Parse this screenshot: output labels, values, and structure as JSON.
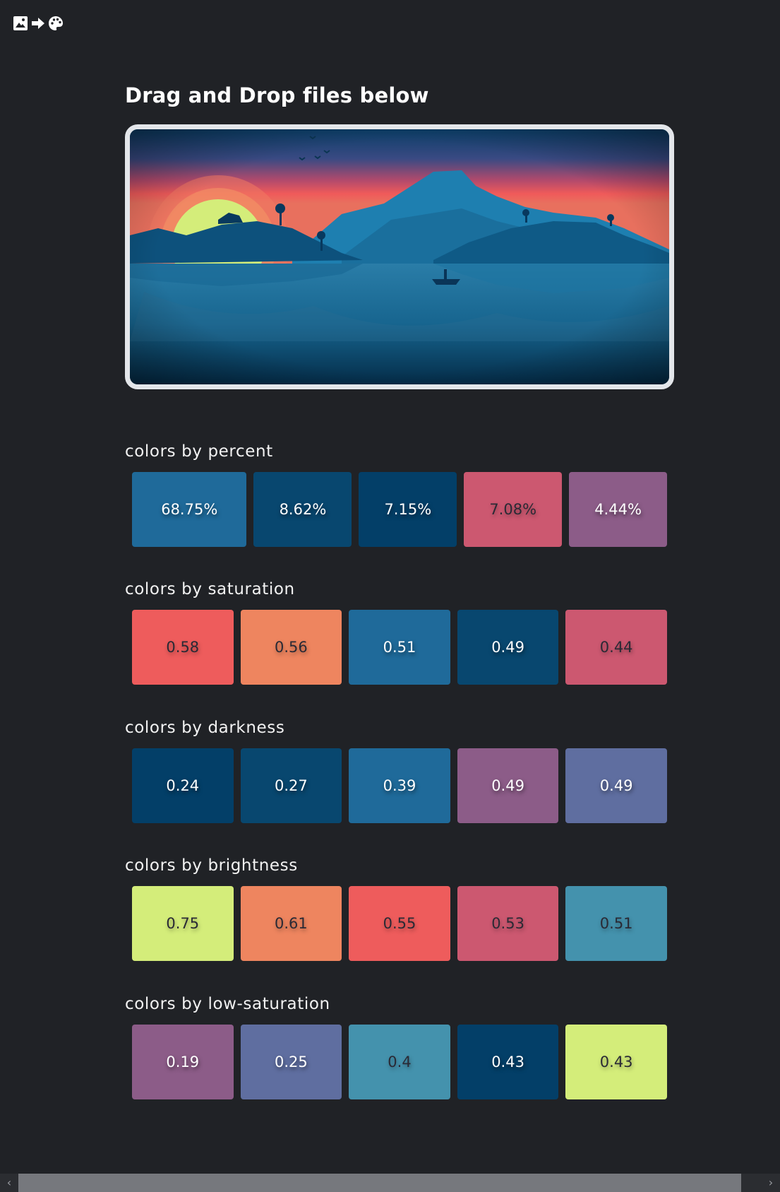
{
  "logo": {
    "icons": [
      "image-icon",
      "arrow-right-icon",
      "palette-icon"
    ]
  },
  "heading": "Drag and Drop files below",
  "dropzone": {
    "image": "sunset-lake-landscape"
  },
  "sections": [
    {
      "title": "colors by percent",
      "swatches": [
        {
          "label": "68.75%",
          "color": "#1f6a9a",
          "light": false
        },
        {
          "label": "8.62%",
          "color": "#08476f",
          "light": false
        },
        {
          "label": "7.15%",
          "color": "#033f68",
          "light": false
        },
        {
          "label": "7.08%",
          "color": "#cc5870",
          "light": true
        },
        {
          "label": "4.44%",
          "color": "#8c5c88",
          "light": false
        }
      ]
    },
    {
      "title": "colors by saturation",
      "swatches": [
        {
          "label": "0.58",
          "color": "#ee5c5c",
          "light": true
        },
        {
          "label": "0.56",
          "color": "#ee855f",
          "light": true
        },
        {
          "label": "0.51",
          "color": "#1f6a9a",
          "light": false
        },
        {
          "label": "0.49",
          "color": "#08476f",
          "light": false
        },
        {
          "label": "0.44",
          "color": "#cc5870",
          "light": true
        }
      ]
    },
    {
      "title": "colors by darkness",
      "swatches": [
        {
          "label": "0.24",
          "color": "#033f68",
          "light": false
        },
        {
          "label": "0.27",
          "color": "#08476f",
          "light": false
        },
        {
          "label": "0.39",
          "color": "#1f6a9a",
          "light": false
        },
        {
          "label": "0.49",
          "color": "#8c5c88",
          "light": false
        },
        {
          "label": "0.49",
          "color": "#5f6ea0",
          "light": false
        }
      ]
    },
    {
      "title": "colors by brightness",
      "swatches": [
        {
          "label": "0.75",
          "color": "#d4ed7a",
          "light": true
        },
        {
          "label": "0.61",
          "color": "#ee855f",
          "light": true
        },
        {
          "label": "0.55",
          "color": "#ee5c5c",
          "light": true
        },
        {
          "label": "0.53",
          "color": "#cc5870",
          "light": true
        },
        {
          "label": "0.51",
          "color": "#4492ad",
          "light": true
        }
      ]
    },
    {
      "title": "colors by low-saturation",
      "swatches": [
        {
          "label": "0.19",
          "color": "#8c5c88",
          "light": false
        },
        {
          "label": "0.25",
          "color": "#5f6ea0",
          "light": false
        },
        {
          "label": "0.4",
          "color": "#4492ad",
          "light": true
        },
        {
          "label": "0.43",
          "color": "#033f68",
          "light": false
        },
        {
          "label": "0.43",
          "color": "#d4ed7a",
          "light": true
        }
      ]
    }
  ],
  "scrollbar": {
    "left_arrow": "‹",
    "right_arrow": "›"
  }
}
